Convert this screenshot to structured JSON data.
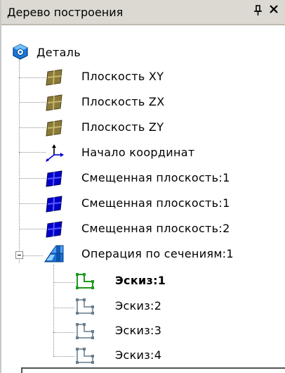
{
  "panel": {
    "title": "Дерево построения",
    "pin_glyph": "ᵖ",
    "close_glyph": "✕"
  },
  "tree": {
    "root": {
      "label": "Деталь",
      "icon": "part-icon"
    },
    "items": [
      {
        "label": "Плоскость XY",
        "icon": "plane-icon",
        "color": "#7b6a2a"
      },
      {
        "label": "Плоскость ZX",
        "icon": "plane-icon",
        "color": "#7b6a2a"
      },
      {
        "label": "Плоскость ZY",
        "icon": "plane-icon",
        "color": "#7b6a2a"
      },
      {
        "label": "Начало координат",
        "icon": "axes-icon",
        "color": "#0000cc"
      },
      {
        "label": "Смещенная плоскость:1",
        "icon": "offset-plane-icon",
        "color": "#0000cc"
      },
      {
        "label": "Смещенная плоскость:1",
        "icon": "offset-plane-icon",
        "color": "#0000cc"
      },
      {
        "label": "Смещенная плоскость:2",
        "icon": "offset-plane-icon",
        "color": "#0000cc"
      },
      {
        "label": "Операция по сечениям:1",
        "icon": "loft-operation-icon",
        "color": "#1a6fd6",
        "expanded": true
      }
    ],
    "children": [
      {
        "label": "Эскиз:1",
        "icon": "sketch-icon",
        "color": "#2aa52a",
        "active": true
      },
      {
        "label": "Эскиз:2",
        "icon": "sketch-icon",
        "color": "#8a9aa8"
      },
      {
        "label": "Эскиз:3",
        "icon": "sketch-icon",
        "color": "#8a9aa8"
      },
      {
        "label": "Эскиз:4",
        "icon": "sketch-icon",
        "color": "#8a9aa8"
      }
    ]
  }
}
